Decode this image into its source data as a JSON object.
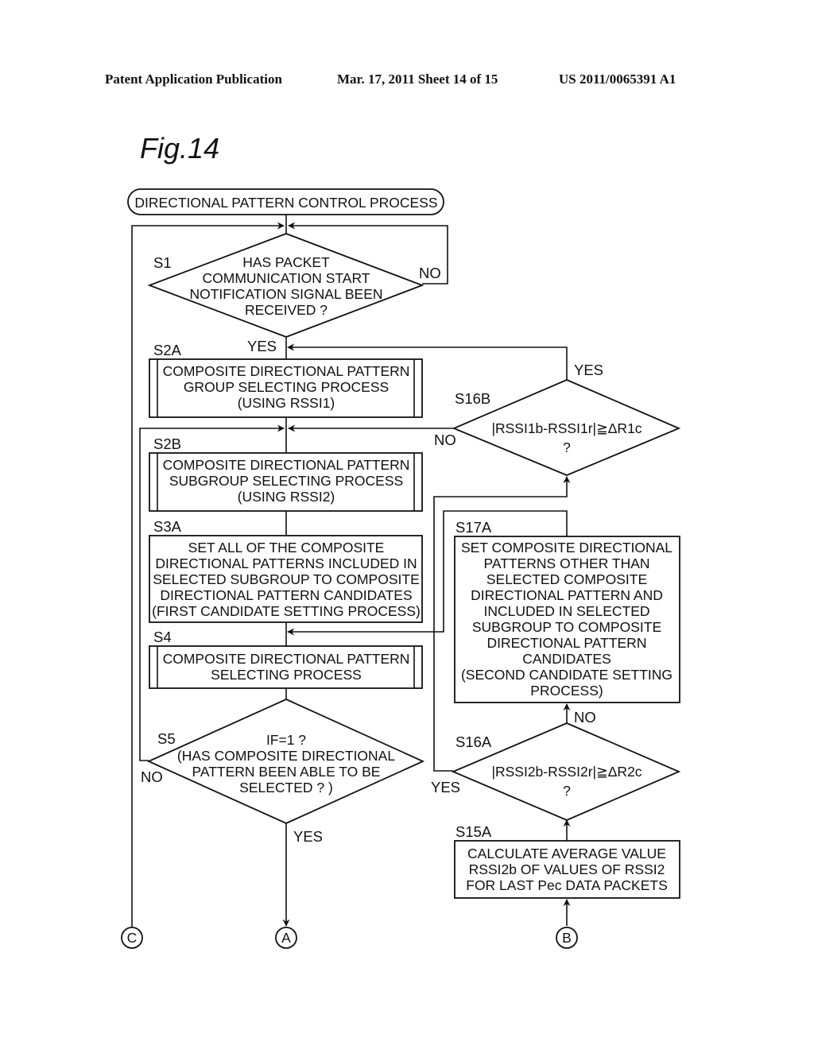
{
  "header": {
    "publication": "Patent Application Publication",
    "date_sheet": "Mar. 17, 2011  Sheet 14 of 15",
    "patent_number": "US 2011/0065391 A1"
  },
  "figure_title": "Fig.14",
  "flowchart": {
    "start": "DIRECTIONAL PATTERN CONTROL PROCESS",
    "steps": {
      "S1": {
        "label": "S1",
        "type": "decision",
        "lines": [
          "HAS PACKET",
          "COMMUNICATION START",
          "NOTIFICATION SIGNAL BEEN",
          "RECEIVED ?"
        ],
        "yes": "YES",
        "no": "NO"
      },
      "S2A": {
        "label": "S2A",
        "type": "subprocess",
        "lines": [
          "COMPOSITE DIRECTIONAL PATTERN",
          "GROUP SELECTING PROCESS",
          "(USING RSSI1)"
        ]
      },
      "S2B": {
        "label": "S2B",
        "type": "subprocess",
        "lines": [
          "COMPOSITE DIRECTIONAL PATTERN",
          "SUBGROUP SELECTING PROCESS",
          "(USING RSSI2)"
        ]
      },
      "S3A": {
        "label": "S3A",
        "type": "process",
        "lines": [
          "SET ALL OF THE COMPOSITE",
          "DIRECTIONAL PATTERNS INCLUDED IN",
          "SELECTED SUBGROUP TO COMPOSITE",
          "DIRECTIONAL PATTERN CANDIDATES",
          "(FIRST CANDIDATE SETTING PROCESS)"
        ]
      },
      "S4": {
        "label": "S4",
        "type": "subprocess",
        "lines": [
          "COMPOSITE DIRECTIONAL PATTERN",
          "SELECTING PROCESS"
        ]
      },
      "S5": {
        "label": "S5",
        "type": "decision",
        "lines": [
          "IF=1 ?",
          "(HAS COMPOSITE DIRECTIONAL",
          "PATTERN BEEN ABLE TO BE",
          "SELECTED ? )"
        ],
        "yes": "YES",
        "no": "NO"
      },
      "S16B": {
        "label": "S16B",
        "type": "decision",
        "lines": [
          "|RSSI1b-RSSI1r|≧ΔR1c",
          "?"
        ],
        "yes": "YES",
        "no": "NO"
      },
      "S17A": {
        "label": "S17A",
        "type": "process",
        "lines": [
          "SET COMPOSITE DIRECTIONAL",
          "PATTERNS OTHER THAN",
          "SELECTED COMPOSITE",
          "DIRECTIONAL PATTERN AND",
          "INCLUDED IN SELECTED",
          "SUBGROUP TO COMPOSITE",
          "DIRECTIONAL PATTERN",
          "CANDIDATES",
          "(SECOND CANDIDATE SETTING",
          "PROCESS)"
        ]
      },
      "S16A": {
        "label": "S16A",
        "type": "decision",
        "lines": [
          "|RSSI2b-RSSI2r|≧ΔR2c",
          "?"
        ],
        "yes": "YES",
        "no": "NO"
      },
      "S15A": {
        "label": "S15A",
        "type": "process",
        "lines": [
          "CALCULATE AVERAGE VALUE",
          "RSSI2b OF VALUES OF RSSI2",
          "FOR LAST Pec DATA PACKETS"
        ]
      }
    },
    "connectors": {
      "A": "A",
      "B": "B",
      "C": "C"
    }
  }
}
